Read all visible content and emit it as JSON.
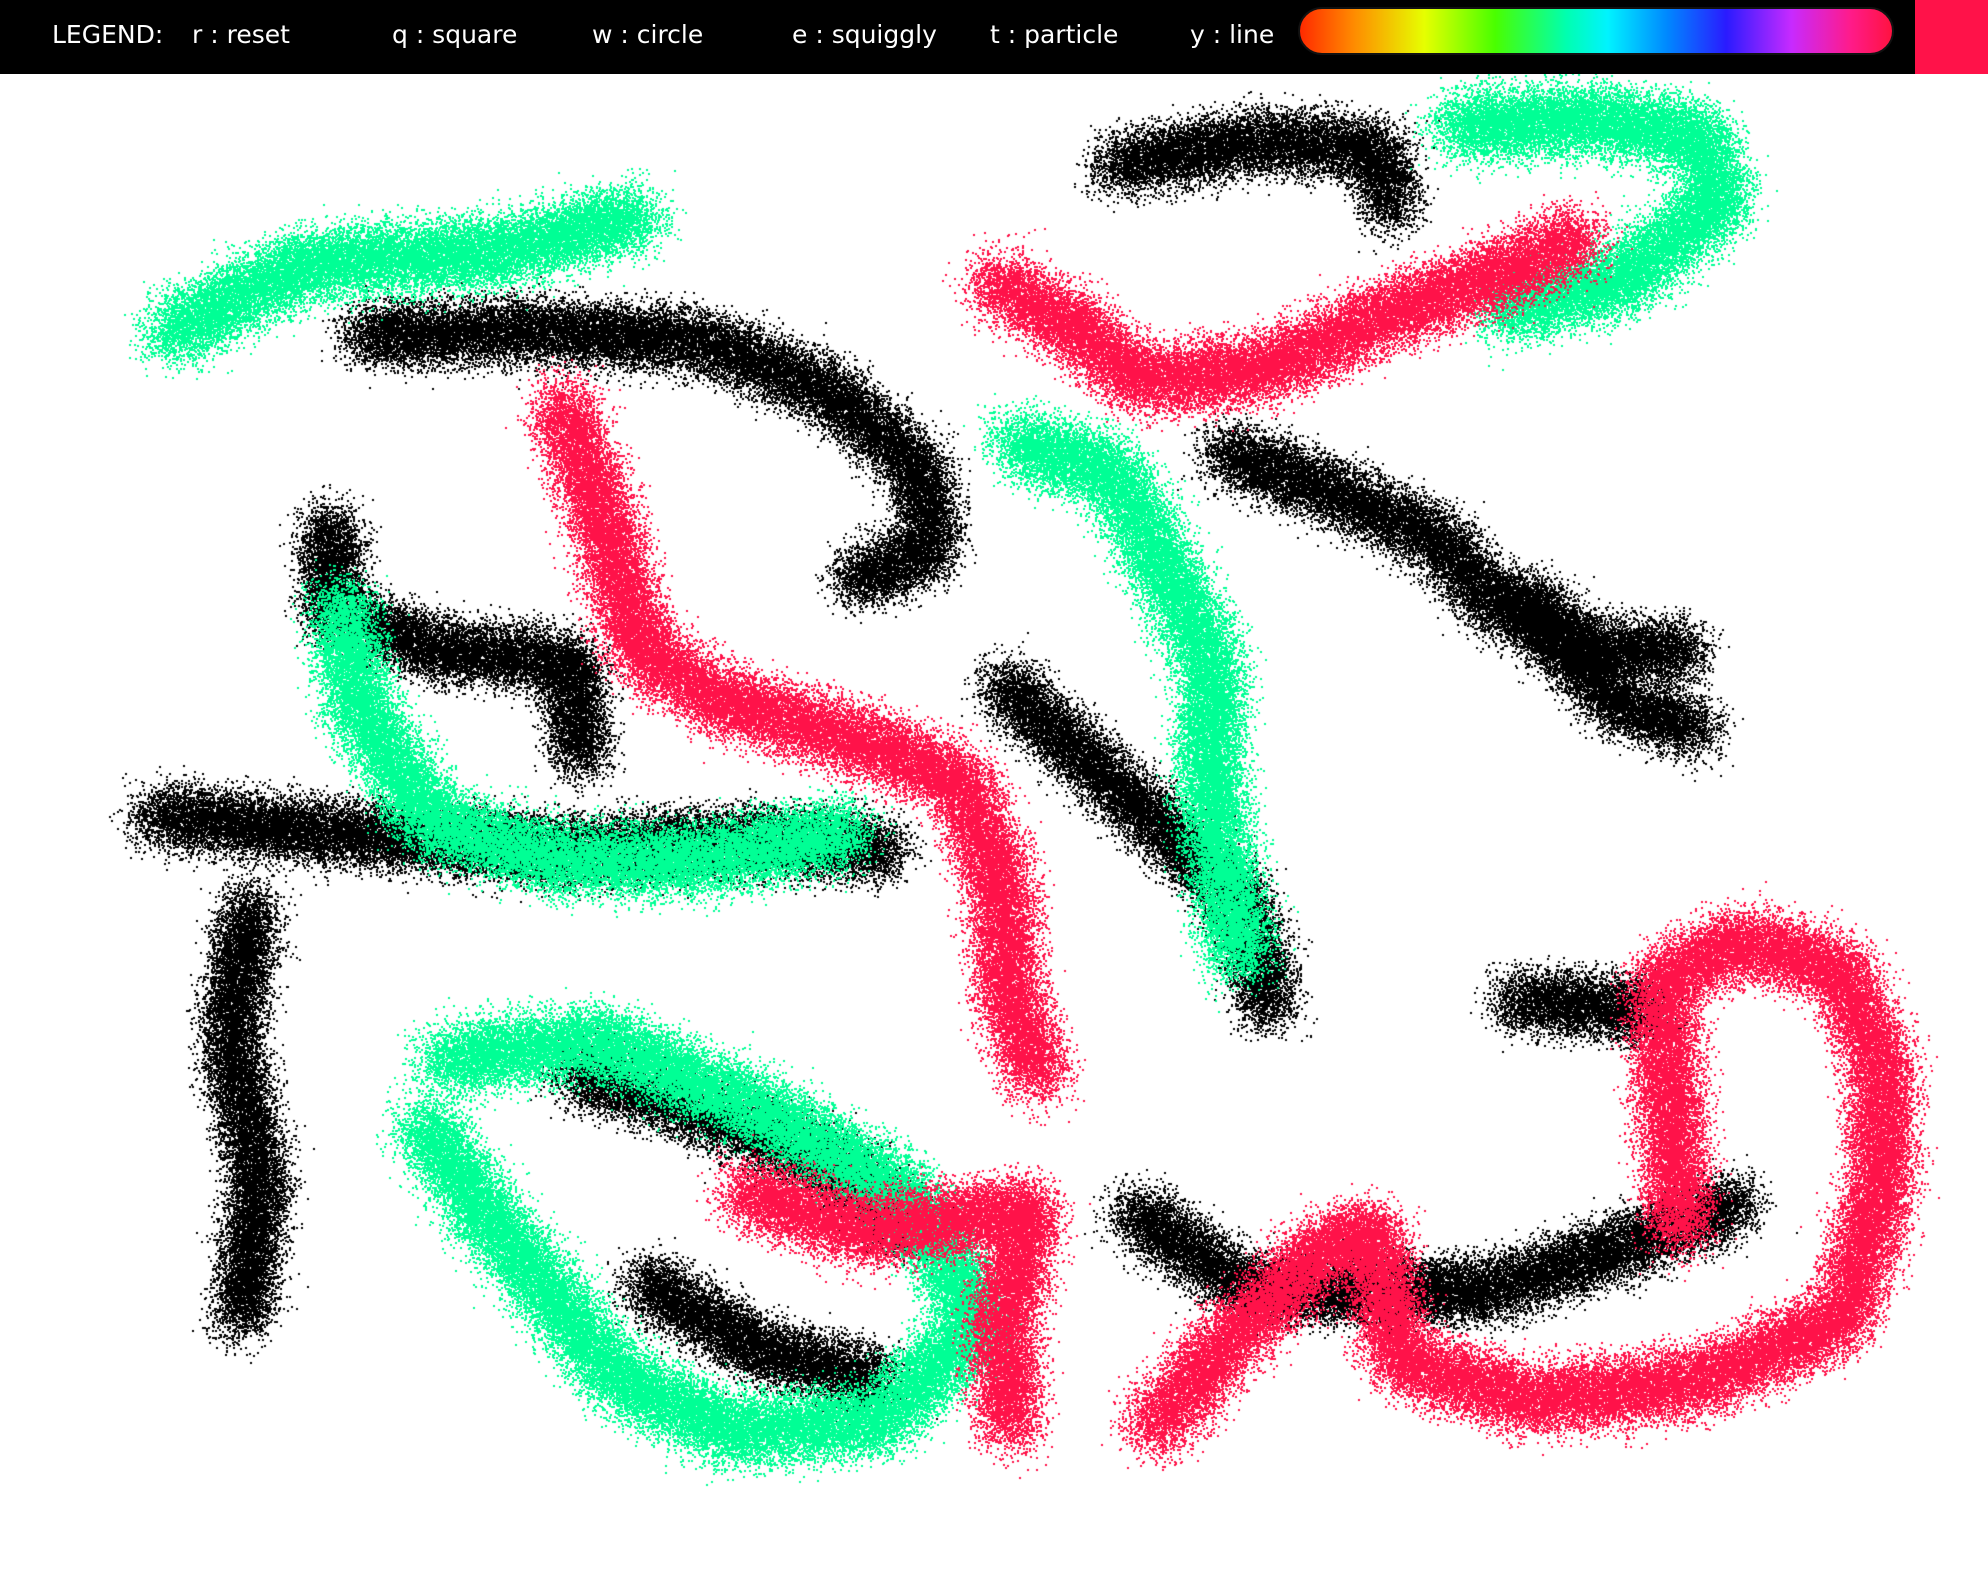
{
  "toolbar": {
    "legend_title": "LEGEND:",
    "shortcuts": [
      {
        "key": "r",
        "label": "r : reset"
      },
      {
        "key": "q",
        "label": "q : square"
      },
      {
        "key": "w",
        "label": "w : circle"
      },
      {
        "key": "e",
        "label": "e : squiggly"
      },
      {
        "key": "t",
        "label": "t : particle"
      },
      {
        "key": "y",
        "label": "y : line"
      }
    ],
    "selected_color": "#ff1249"
  },
  "canvas": {
    "background": "#ffffff",
    "stroke_colors": {
      "black": "#000000",
      "green": "#00ff95",
      "red": "#ff1249"
    }
  }
}
